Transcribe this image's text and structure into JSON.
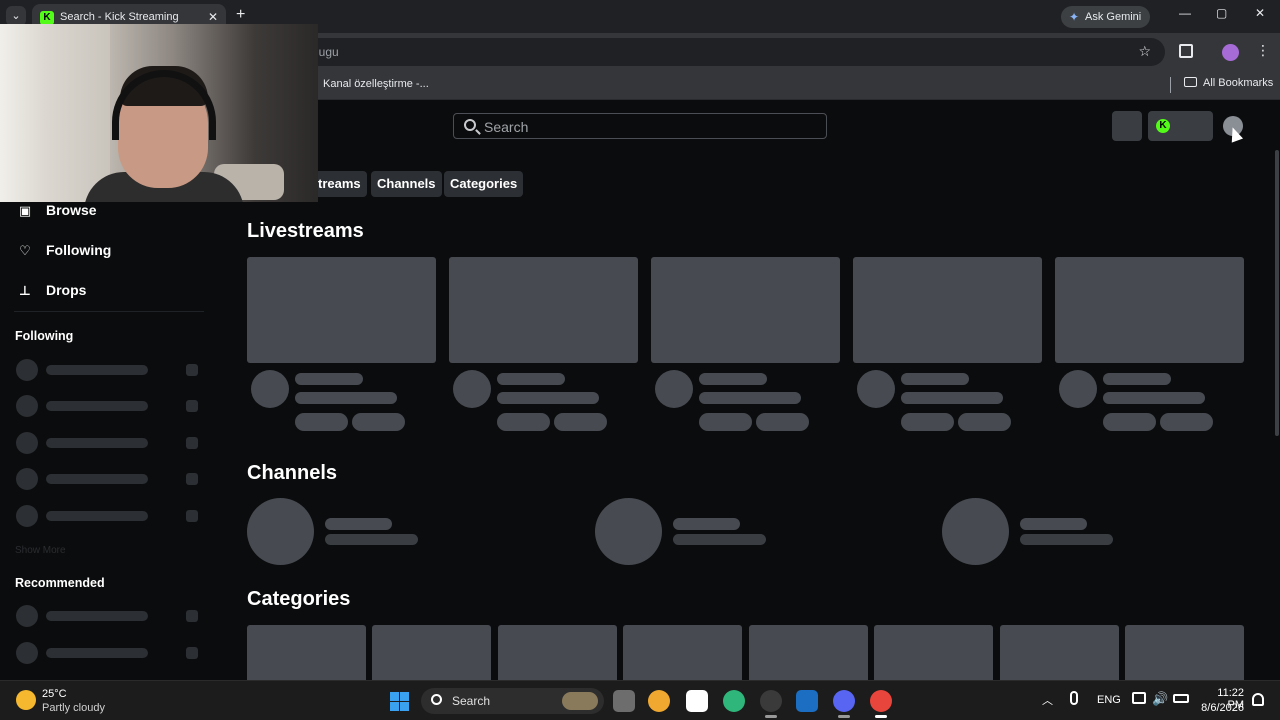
{
  "browser": {
    "tab_title": "Search - Kick Streaming",
    "tab_favicon": "K",
    "new_tab": "+",
    "tab_dropdown": "⌄",
    "tab_close": "✕",
    "ask_gemini": "Ask Gemini",
    "window_controls": {
      "minimize": "—",
      "maximize": "▢",
      "close": "✕"
    },
    "url_fragment": "lugu",
    "bookmark_1": "Kanal özelleştirme -...",
    "all_bookmarks": "All Bookmarks",
    "star": "☆",
    "menu": "⋮"
  },
  "header": {
    "search_placeholder": "Search",
    "kick_icon": "K"
  },
  "filters": [
    "treams",
    "Channels",
    "Categories"
  ],
  "sidebar": {
    "nav": [
      {
        "label": "Browse",
        "icon": "browse-icon",
        "glyph": "▣"
      },
      {
        "label": "Following",
        "icon": "heart-icon",
        "glyph": "♡"
      },
      {
        "label": "Drops",
        "icon": "drops-icon",
        "glyph": "⊥"
      }
    ],
    "following_heading": "Following",
    "show_more": "Show More",
    "recommended_heading": "Recommended"
  },
  "main": {
    "livestreams_title": "Livestreams",
    "channels_title": "Channels",
    "categories_title": "Categories"
  },
  "taskbar": {
    "temperature": "25°C",
    "weather": "Partly cloudy",
    "search_label": "Search",
    "language": "ENG",
    "time": "11:22 PM",
    "date": "8/6/2026",
    "tray_chevron": "︿",
    "volume_glyph": "🔊"
  },
  "colors": {
    "kick_green": "#53fc18",
    "skeleton": "#474b51",
    "background": "#0b0c0d"
  }
}
